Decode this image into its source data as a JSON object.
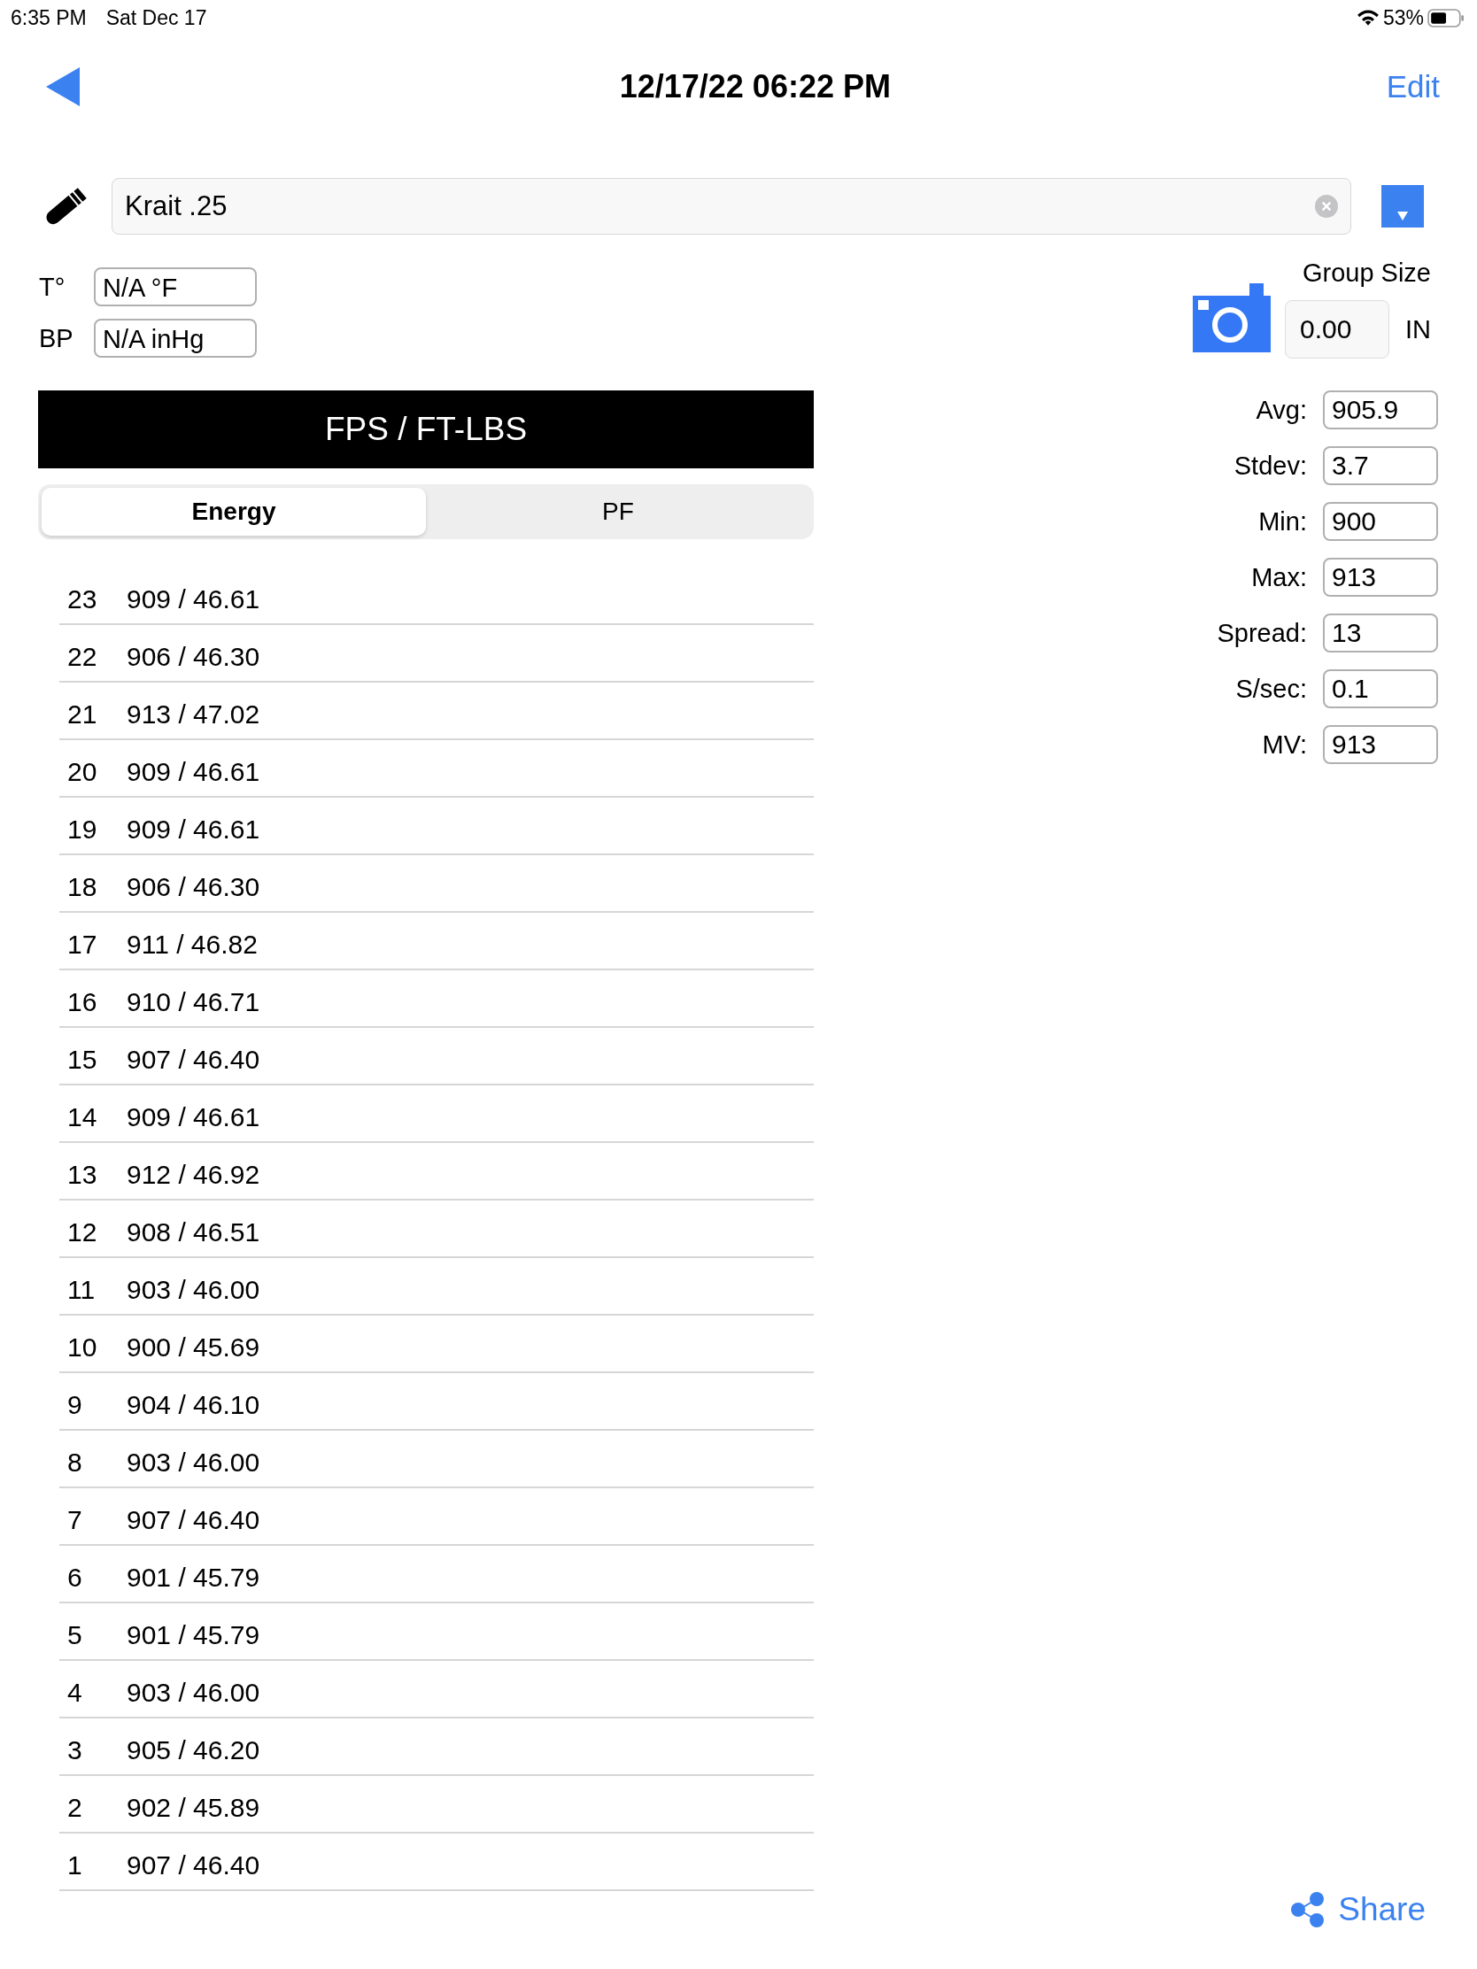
{
  "status_bar": {
    "time": "6:35 PM",
    "date": "Sat Dec 17",
    "battery": "53%"
  },
  "nav": {
    "title": "12/17/22 06:22 PM",
    "edit": "Edit"
  },
  "ammo": {
    "value": "Krait .25"
  },
  "environment": [
    {
      "label": "T°",
      "value": "N/A °F"
    },
    {
      "label": "BP",
      "value": "N/A inHg"
    }
  ],
  "group_size": {
    "label": "Group Size",
    "value": "0.00",
    "unit": "IN"
  },
  "header": "FPS / FT-LBS",
  "tabs": [
    {
      "label": "Energy",
      "selected": true
    },
    {
      "label": "PF",
      "selected": false
    }
  ],
  "shots": [
    {
      "number": "23",
      "reading": "909 / 46.61"
    },
    {
      "number": "22",
      "reading": "906 / 46.30"
    },
    {
      "number": "21",
      "reading": "913 / 47.02"
    },
    {
      "number": "20",
      "reading": "909 / 46.61"
    },
    {
      "number": "19",
      "reading": "909 / 46.61"
    },
    {
      "number": "18",
      "reading": "906 / 46.30"
    },
    {
      "number": "17",
      "reading": "911 / 46.82"
    },
    {
      "number": "16",
      "reading": "910 / 46.71"
    },
    {
      "number": "15",
      "reading": "907 / 46.40"
    },
    {
      "number": "14",
      "reading": "909 / 46.61"
    },
    {
      "number": "13",
      "reading": "912 / 46.92"
    },
    {
      "number": "12",
      "reading": "908 / 46.51"
    },
    {
      "number": "11",
      "reading": "903 / 46.00"
    },
    {
      "number": "10",
      "reading": "900 / 45.69"
    },
    {
      "number": "9",
      "reading": "904 / 46.10"
    },
    {
      "number": "8",
      "reading": "903 / 46.00"
    },
    {
      "number": "7",
      "reading": "907 / 46.40"
    },
    {
      "number": "6",
      "reading": "901 / 45.79"
    },
    {
      "number": "5",
      "reading": "901 / 45.79"
    },
    {
      "number": "4",
      "reading": "903 / 46.00"
    },
    {
      "number": "3",
      "reading": "905 / 46.20"
    },
    {
      "number": "2",
      "reading": "902 / 45.89"
    },
    {
      "number": "1",
      "reading": "907 / 46.40"
    }
  ],
  "stats": [
    {
      "label": "Avg:",
      "value": "905.9"
    },
    {
      "label": "Stdev:",
      "value": "3.7"
    },
    {
      "label": "Min:",
      "value": "900"
    },
    {
      "label": "Max:",
      "value": "913"
    },
    {
      "label": "Spread:",
      "value": "13"
    },
    {
      "label": "S/sec:",
      "value": "0.1"
    },
    {
      "label": "MV:",
      "value": "913"
    }
  ],
  "share": {
    "label": "Share"
  }
}
